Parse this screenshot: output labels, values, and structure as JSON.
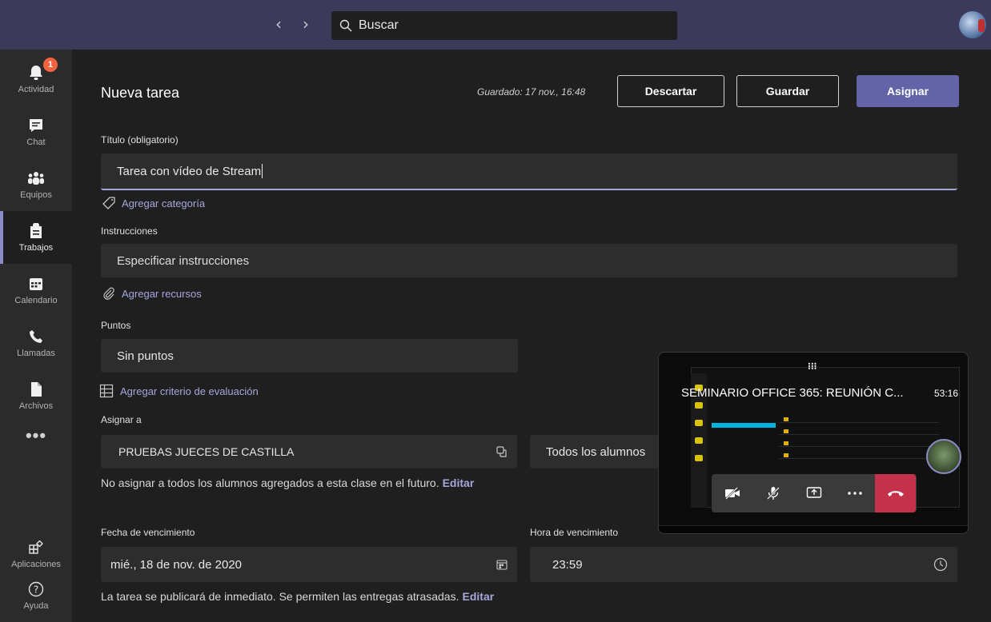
{
  "topbar": {
    "back_arrow": "‹",
    "forward_arrow": "›",
    "search_placeholder": "Buscar"
  },
  "rail": {
    "items": [
      {
        "label": "Actividad",
        "icon": "bell-icon",
        "badge": "1"
      },
      {
        "label": "Chat",
        "icon": "chat-icon"
      },
      {
        "label": "Equipos",
        "icon": "teams-icon"
      },
      {
        "label": "Trabajos",
        "icon": "assignments-icon",
        "active": true
      },
      {
        "label": "Calendario",
        "icon": "calendar-icon"
      },
      {
        "label": "Llamadas",
        "icon": "phone-icon"
      },
      {
        "label": "Archivos",
        "icon": "file-icon"
      },
      {
        "label": "•••",
        "icon": "more-icon"
      },
      {
        "label": "Aplicaciones",
        "icon": "apps-icon"
      },
      {
        "label": "Ayuda",
        "icon": "help-icon"
      }
    ]
  },
  "header": {
    "title": "Nueva tarea",
    "saved": "Guardado: 17 nov., 16:48",
    "discard_label": "Descartar",
    "save_label": "Guardar",
    "assign_label": "Asignar"
  },
  "form": {
    "title_label": "Título (obligatorio)",
    "title_value": "Tarea con vídeo de Stream",
    "add_category": "Agregar categoría",
    "instructions_label": "Instrucciones",
    "instructions_placeholder": "Especificar instrucciones",
    "add_resources": "Agregar recursos",
    "points_label": "Puntos",
    "points_value": "Sin puntos",
    "add_rubric": "Agregar criterio de evaluación",
    "assign_to_label": "Asignar a",
    "class_value": "PRUEBAS JUECES DE CASTILLA",
    "students_value": "Todos los alumnos",
    "future_note": "No asignar a todos los alumnos agregados a esta clase en el futuro.",
    "future_edit": "Editar",
    "due_date_label": "Fecha de vencimiento",
    "due_date_value": "mié., 18 de nov. de 2020",
    "due_time_label": "Hora de vencimiento",
    "due_time_value": "23:59",
    "publish_note": "La tarea se publicará de inmediato. Se permiten las entregas atrasadas.",
    "publish_edit": "Editar"
  },
  "video": {
    "title": "SEMINARIO OFFICE 365: REUNIÓN C...",
    "duration": "53:16",
    "grid_glyph": "⁝⁝⁝"
  },
  "colors": {
    "accent": "#6264a7",
    "link": "#a6a7dc",
    "badge": "#f1623f",
    "hangup": "#c4314b"
  }
}
